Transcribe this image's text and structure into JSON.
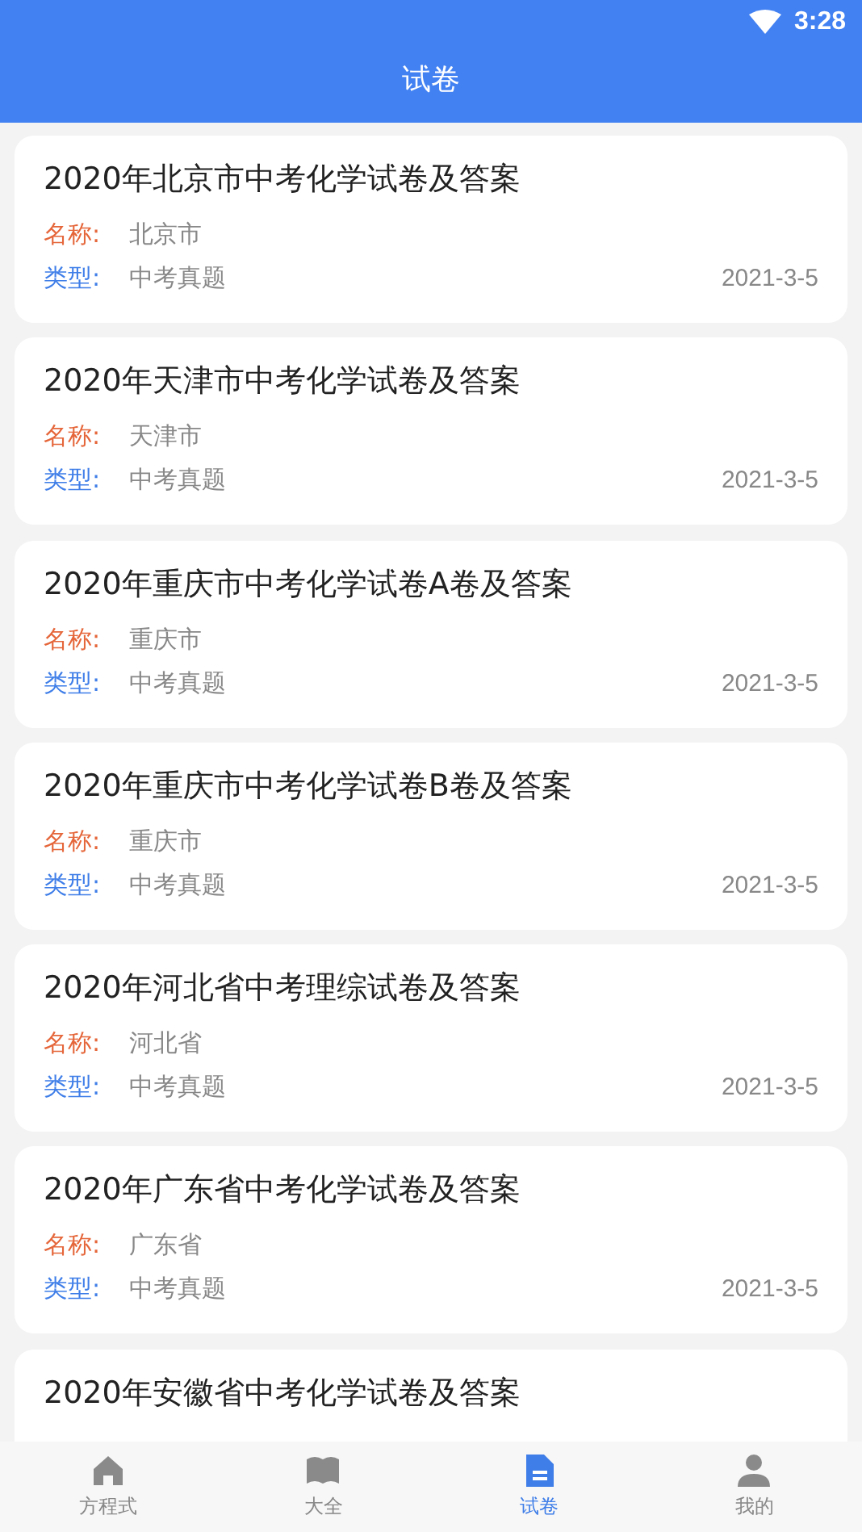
{
  "status_bar": {
    "time": "3:28"
  },
  "header": {
    "title": "试卷"
  },
  "papers": [
    {
      "title": "2020年北京市中考化学试卷及答案",
      "name_label": "名称:",
      "name": "北京市",
      "type_label": "类型:",
      "type": "中考真题",
      "date": "2021-3-5"
    },
    {
      "title": "2020年天津市中考化学试卷及答案",
      "name_label": "名称:",
      "name": "天津市",
      "type_label": "类型:",
      "type": "中考真题",
      "date": "2021-3-5"
    },
    {
      "title": "2020年重庆市中考化学试卷A卷及答案",
      "name_label": "名称:",
      "name": "重庆市",
      "type_label": "类型:",
      "type": "中考真题",
      "date": "2021-3-5"
    },
    {
      "title": "2020年重庆市中考化学试卷B卷及答案",
      "name_label": "名称:",
      "name": "重庆市",
      "type_label": "类型:",
      "type": "中考真题",
      "date": "2021-3-5"
    },
    {
      "title": "2020年河北省中考理综试卷及答案",
      "name_label": "名称:",
      "name": "河北省",
      "type_label": "类型:",
      "type": "中考真题",
      "date": "2021-3-5"
    },
    {
      "title": "2020年广东省中考化学试卷及答案",
      "name_label": "名称:",
      "name": "广东省",
      "type_label": "类型:",
      "type": "中考真题",
      "date": "2021-3-5"
    },
    {
      "title": "2020年安徽省中考化学试卷及答案"
    }
  ],
  "nav": [
    {
      "kind": "home",
      "label": "方程式",
      "selected": false
    },
    {
      "kind": "book",
      "label": "大全",
      "selected": false
    },
    {
      "kind": "doc",
      "label": "试卷",
      "selected": true
    },
    {
      "kind": "person",
      "label": "我的",
      "selected": false
    }
  ]
}
